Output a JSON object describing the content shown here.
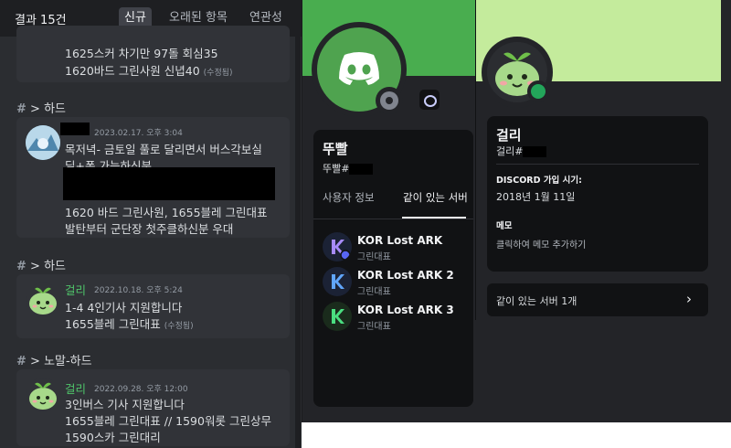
{
  "search": {
    "result_count": "결과 15건",
    "tabs": [
      {
        "label": "신규",
        "active": true
      },
      {
        "label": "오래된 항목",
        "active": false
      },
      {
        "label": "연관성",
        "active": false
      }
    ]
  },
  "results": [
    {
      "lines": [
        "1625스커 차기만 97돌 회심35",
        "1620바드 그린사원 신녑40"
      ],
      "edited": "(수정됨)"
    },
    {
      "channel": "> 하드",
      "timestamp": "2023.02.17. 오후 3:04",
      "lines": [
        "목저녁- 금토일 풀로 달리면서 버스각보실",
        "딜+폿 가능하신분",
        "1620 바드 그린사원, 1655블레 그린대표",
        "발탄부터 군단장 첫주클하신분 우대"
      ]
    },
    {
      "channel": "> 하드",
      "author": "걸리",
      "timestamp": "2022.10.18. 오후 5:24",
      "lines": [
        "1-4 4인기사 지원합니다",
        "1655블레 그린대표"
      ],
      "edited": "(수정됨)"
    },
    {
      "channel": "> 노말-하드",
      "author": "걸리",
      "timestamp": "2022.09.28. 오후 12:00",
      "lines": [
        "3인버스 기사 지원합니다",
        "1655블레 그린대표 // 1590워롯 그린상무",
        "1590스카 그린대리"
      ]
    }
  ],
  "profile_middle": {
    "name": "뚜빨",
    "tag": "뚜빨#",
    "tabs": [
      {
        "label": "사용자 정보",
        "active": false
      },
      {
        "label": "같이 있는 서버",
        "active": true
      }
    ],
    "servers": [
      {
        "name": "KOR Lost ARK",
        "sub": "그린대표",
        "color": "#a78bfa"
      },
      {
        "name": "KOR Lost ARK 2",
        "sub": "그린대표",
        "color": "#60a5fa"
      },
      {
        "name": "KOR Lost ARK 3",
        "sub": "그린대표",
        "color": "#4ade80"
      }
    ]
  },
  "profile_popup": {
    "name": "걸리",
    "tag": "걸리#",
    "joined_label": "DISCORD 가입 시기:",
    "joined_value": "2018년 1월 11일",
    "memo_label": "메모",
    "memo_placeholder": "클릭하여 메모 추가하기",
    "mutual_servers": "같이 있는 서버 1개"
  },
  "colors": {
    "accent_green": "#4fc46a",
    "banner_green": "#49ad4f",
    "banner_light_green": "#c4eb9c",
    "online": "#23a55a"
  },
  "icons": {
    "channel": "hash-icon",
    "discord": "discord-logo-icon",
    "chevron": "chevron-right-icon"
  }
}
